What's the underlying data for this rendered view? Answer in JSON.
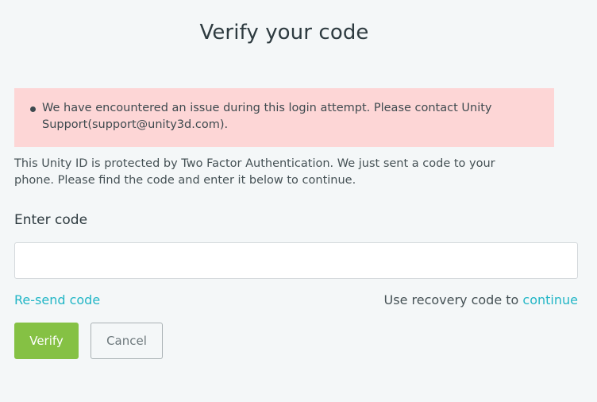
{
  "page": {
    "title": "Verify your code"
  },
  "alert": {
    "message": "We have encountered an issue during this login attempt. Please contact Unity Support(support@unity3d.com)."
  },
  "description": "This Unity ID is protected by Two Factor Authentication. We just sent a code to your phone. Please find the code and enter it below to continue.",
  "form": {
    "code_label": "Enter code",
    "code_value": "",
    "code_placeholder": ""
  },
  "links": {
    "resend": "Re-send code",
    "recovery_prefix": "Use recovery code to ",
    "recovery_link": "continue"
  },
  "buttons": {
    "verify": "Verify",
    "cancel": "Cancel"
  },
  "colors": {
    "accent": "#22b6c6",
    "primary_button": "#85c144",
    "alert_background": "#fdd6d6"
  }
}
